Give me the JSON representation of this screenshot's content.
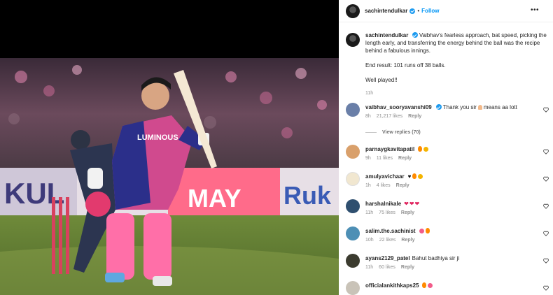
{
  "post": {
    "author": "sachintendulkar",
    "follow_label": "Follow",
    "separator": "•",
    "caption_author": "sachintendulkar",
    "caption_paragraphs": [
      "Vaibhav's fearless approach, bat speed, picking the length early, and transferring the energy behind the ball was the recipe behind a fabulous innings.",
      "End result: 101 runs off 38 balls.",
      "Well played!!"
    ],
    "caption_time": "11h"
  },
  "photo": {
    "jersey_text": "LUMINOUS",
    "banner_texts": [
      "KUL",
      "MAY",
      "Ruk"
    ]
  },
  "comments": [
    {
      "user": "vaibhav_sooryavanshi09",
      "verified": true,
      "text_before": "Thank you sir",
      "text_after": "means aa lott",
      "emoji": "pray",
      "time": "8h",
      "likes": "21,217 likes",
      "reply": "Reply",
      "avatar_color": "#6a7fa8"
    },
    {
      "user": "parnaygkavitapatil",
      "text": "",
      "emoji": [
        "fire",
        "clap"
      ],
      "time": "9h",
      "likes": "11 likes",
      "reply": "Reply",
      "avatar_color": "#d9a06b"
    },
    {
      "user": "amulyavichaar",
      "text": "",
      "emoji": [
        "blackheart",
        "fire",
        "clap"
      ],
      "time": "1h",
      "likes": "4 likes",
      "reply": "Reply",
      "avatar_color": "#f1e7d0"
    },
    {
      "user": "harshalnikale",
      "text": "",
      "emoji": [
        "heart",
        "heart",
        "heart"
      ],
      "time": "11h",
      "likes": "75 likes",
      "reply": "Reply",
      "avatar_color": "#2f4f6f"
    },
    {
      "user": "salim.the.sachinist",
      "text": "",
      "emoji": [
        "smile",
        "fire"
      ],
      "time": "10h",
      "likes": "22 likes",
      "reply": "Reply",
      "avatar_color": "#4d8fb5"
    },
    {
      "user": "ayans2129_patel",
      "text": "Bahut badhiya sir ji",
      "time": "11h",
      "likes": "60 likes",
      "reply": "Reply",
      "avatar_color": "#3b3b2f"
    },
    {
      "user": "officialankithkaps25",
      "text": "",
      "emoji": [
        "fire",
        "smile"
      ],
      "time": "",
      "likes": "",
      "reply": "",
      "avatar_color": "#c9c3b8"
    }
  ],
  "view_replies": "View replies (70)",
  "colors": {
    "accent": "#0095f6",
    "verified": "#1d9bf0",
    "muted": "#8e8e8e",
    "heart_emoji": "#e0245e"
  },
  "icons": [
    "more-icon",
    "verified-icon",
    "heart-icon"
  ]
}
